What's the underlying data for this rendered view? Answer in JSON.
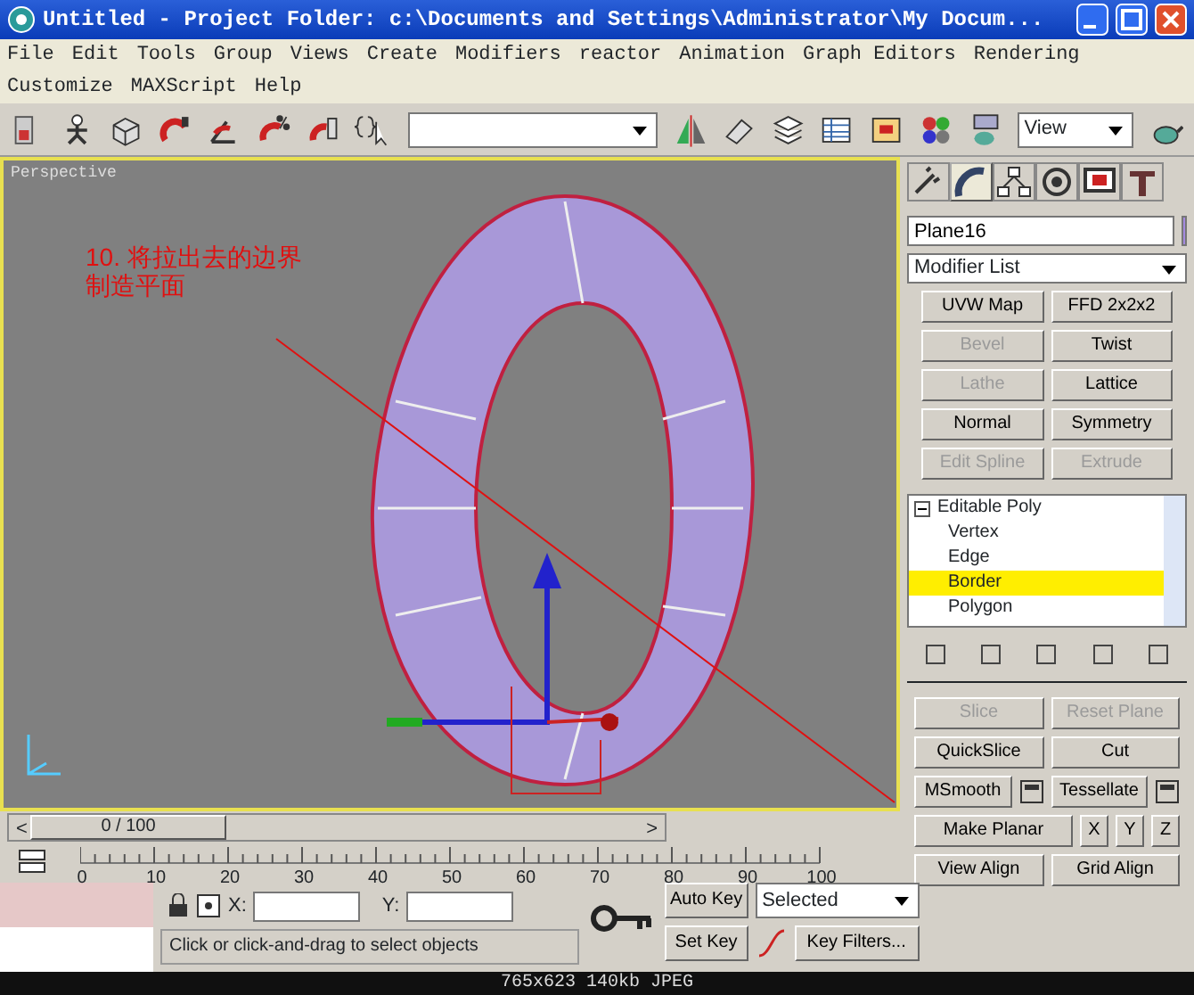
{
  "window": {
    "title": "Untitled      - Project Folder: c:\\Documents and Settings\\Administrator\\My Docum..."
  },
  "menu": [
    "File",
    "Edit",
    "Tools",
    "Group",
    "Views",
    "Create",
    "Modifiers",
    "reactor",
    "Animation",
    "Graph Editors",
    "Rendering",
    "Customize",
    "MAXScript",
    "Help"
  ],
  "toolbar": {
    "view_dropdown": "View"
  },
  "viewport": {
    "label": "Perspective",
    "annotation": [
      "10. 将拉出去的边界",
      "制造平面"
    ]
  },
  "command_panel": {
    "tabs": [
      {
        "selected": false
      },
      {
        "selected": true
      },
      {
        "selected": false
      },
      {
        "selected": false
      },
      {
        "selected": false
      },
      {
        "selected": false
      }
    ],
    "object_name": "Plane16",
    "modifier_list": "Modifier List",
    "modifier_buttons": [
      {
        "label": "UVW Map",
        "disabled": false
      },
      {
        "label": "FFD 2x2x2",
        "disabled": false
      },
      {
        "label": "Bevel",
        "disabled": true
      },
      {
        "label": "Twist",
        "disabled": false
      },
      {
        "label": "Lathe",
        "disabled": true
      },
      {
        "label": "Lattice",
        "disabled": false
      },
      {
        "label": "Normal",
        "disabled": false
      },
      {
        "label": "Symmetry",
        "disabled": false
      },
      {
        "label": "Edit Spline",
        "disabled": true
      },
      {
        "label": "Extrude",
        "disabled": true
      }
    ],
    "stack": [
      {
        "label": "Editable Poly",
        "selected": false,
        "children": [
          {
            "label": "Vertex",
            "selected": false
          },
          {
            "label": "Edge",
            "selected": false
          },
          {
            "label": "Border",
            "selected": true
          },
          {
            "label": "Polygon",
            "selected": false
          }
        ]
      }
    ],
    "edit_geometry": [
      {
        "kind": "pair",
        "buttons": [
          {
            "label": "Slice",
            "disabled": true
          },
          {
            "label": "Reset Plane",
            "disabled": true
          }
        ]
      },
      {
        "kind": "pair",
        "buttons": [
          {
            "label": "QuickSlice",
            "disabled": false
          },
          {
            "label": "Cut",
            "disabled": false
          }
        ]
      },
      {
        "kind": "settings",
        "buttons": [
          {
            "label": "MSmooth",
            "disabled": false
          },
          {
            "label": "Tessellate",
            "disabled": false
          }
        ]
      },
      {
        "kind": "planar",
        "buttons": [
          {
            "label": "Make Planar",
            "disabled": false
          },
          {
            "label": "X",
            "disabled": false
          },
          {
            "label": "Y",
            "disabled": false
          },
          {
            "label": "Z",
            "disabled": false
          }
        ]
      },
      {
        "kind": "pair",
        "buttons": [
          {
            "label": "View Align",
            "disabled": false
          },
          {
            "label": "Grid Align",
            "disabled": false
          }
        ]
      }
    ]
  },
  "timeline": {
    "previous": "<",
    "next": ">",
    "frame": "0 / 100",
    "level": 0,
    "ticks": [
      "0",
      "10",
      "20",
      "30",
      "40",
      "50",
      "60",
      "70",
      "80",
      "90",
      "100"
    ]
  },
  "status": {
    "x_label": "X:",
    "y_label": "Y:",
    "prompt": "Click or click-and-drag to select objects",
    "auto_key": "Auto Key",
    "set_key": "Set Key",
    "key_mode": "Selected",
    "key_filters": "Key Filters..."
  },
  "caption": "765x623 140kb JPEG"
}
